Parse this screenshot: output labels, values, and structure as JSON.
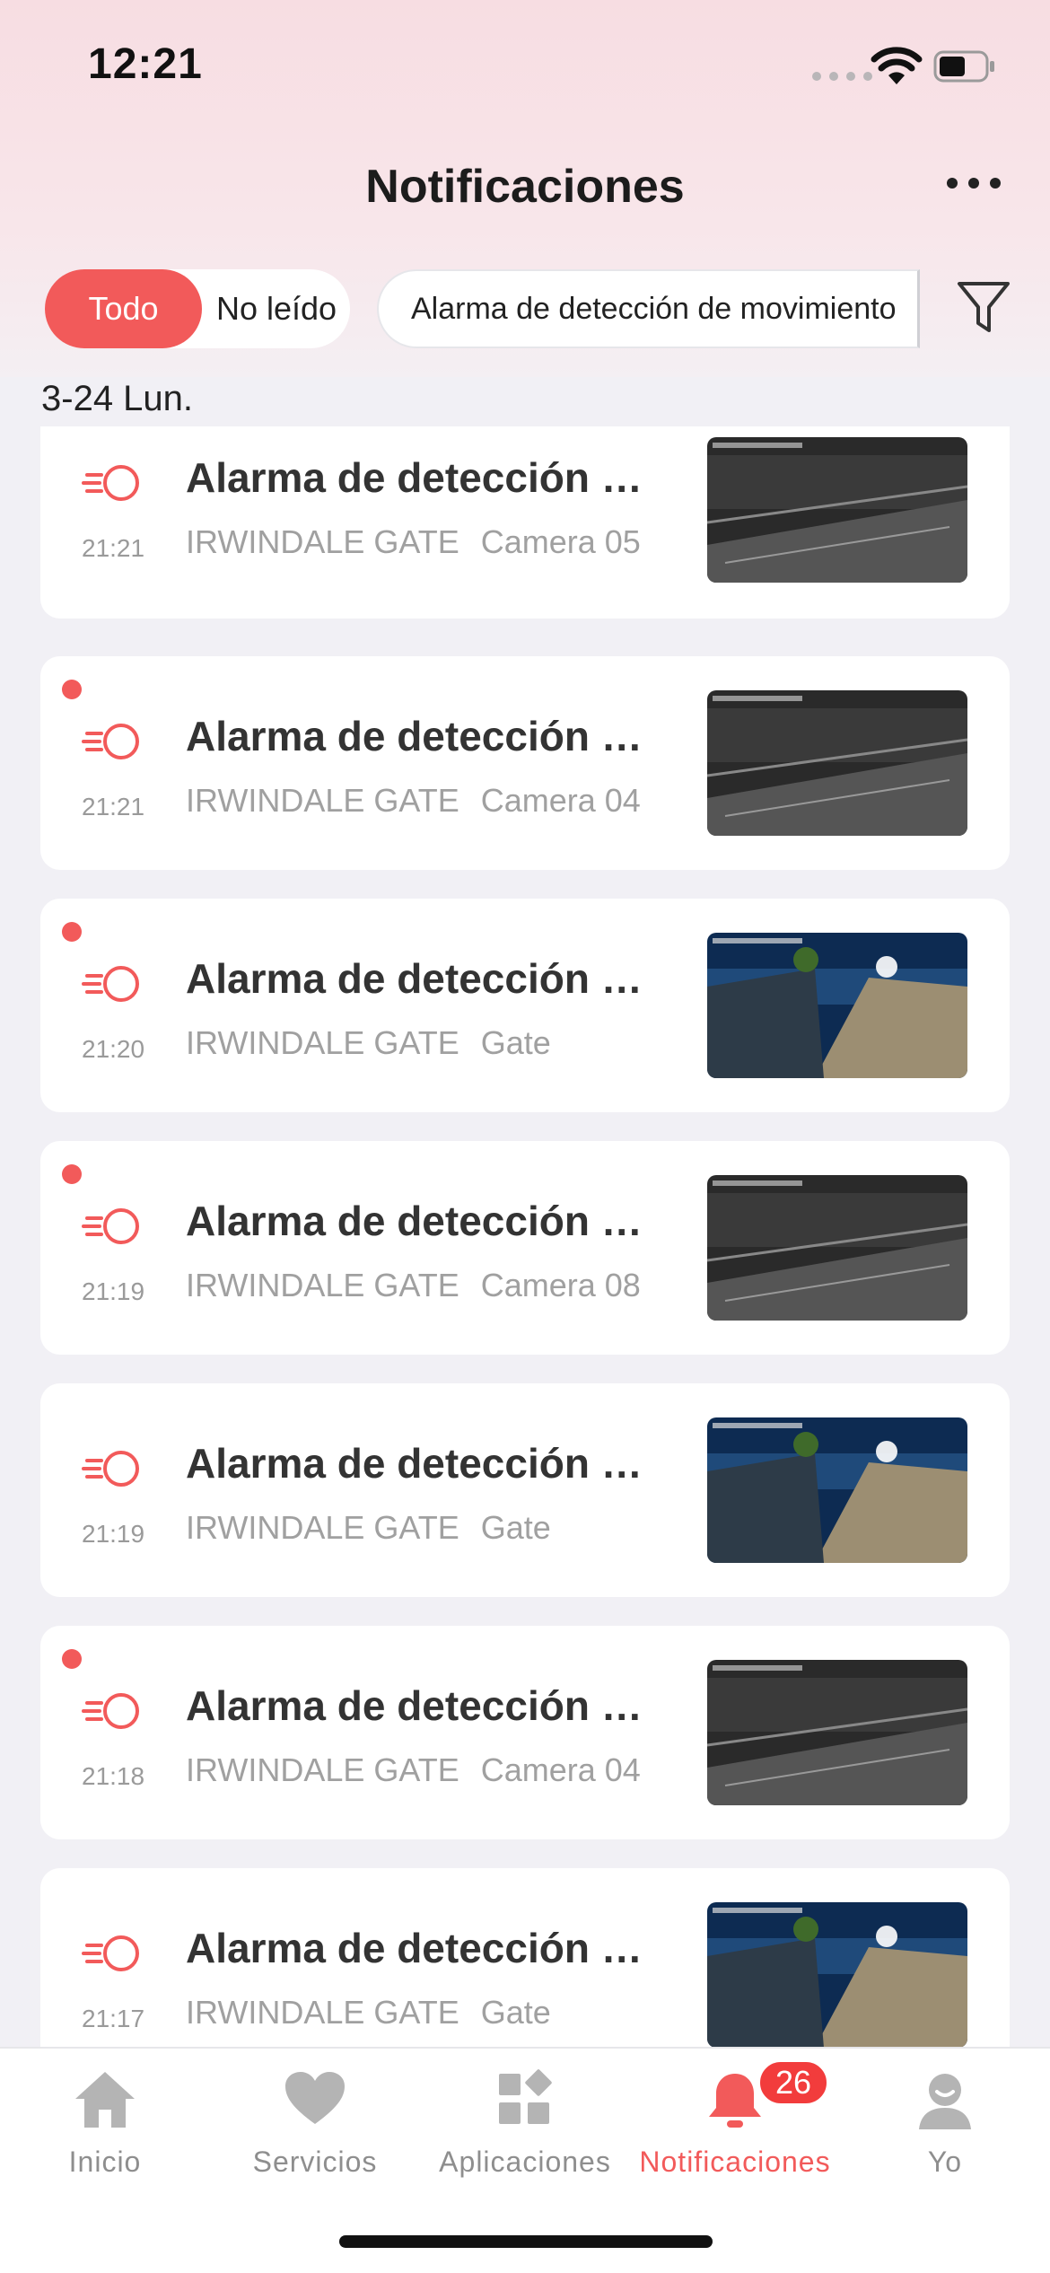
{
  "status_bar": {
    "time": "12:21"
  },
  "header": {
    "title": "Notificaciones",
    "more_icon": "ellipsis-icon"
  },
  "filters": {
    "all_label": "Todo",
    "unread_label": "No leído",
    "type_filter_value": "Alarma de detección de movimiento",
    "filter_icon": "funnel-icon"
  },
  "colors": {
    "accent": "#f25a5a",
    "badge": "#f23c3c"
  },
  "date_header": "3-24 Lun.",
  "notifications": [
    {
      "title": "Alarma de detección de movimiento",
      "time": "21:21",
      "site": "IRWINDALE GATE",
      "camera": "Camera 05",
      "unread": false,
      "thumb": "gray"
    },
    {
      "title": "Alarma de detección de movimiento",
      "time": "21:21",
      "site": "IRWINDALE GATE",
      "camera": "Camera 04",
      "unread": true,
      "thumb": "gray"
    },
    {
      "title": "Alarma de detección de movimiento",
      "time": "21:20",
      "site": "IRWINDALE GATE",
      "camera": "Gate",
      "unread": true,
      "thumb": "color"
    },
    {
      "title": "Alarma de detección de movimiento",
      "time": "21:19",
      "site": "IRWINDALE GATE",
      "camera": "Camera 08",
      "unread": true,
      "thumb": "gray"
    },
    {
      "title": "Alarma de detección de movimiento",
      "time": "21:19",
      "site": "IRWINDALE GATE",
      "camera": "Gate",
      "unread": false,
      "thumb": "color"
    },
    {
      "title": "Alarma de detección de movimiento",
      "time": "21:18",
      "site": "IRWINDALE GATE",
      "camera": "Camera 04",
      "unread": true,
      "thumb": "gray"
    },
    {
      "title": "Alarma de detección de movimiento",
      "time": "21:17",
      "site": "IRWINDALE GATE",
      "camera": "Gate",
      "unread": false,
      "thumb": "color"
    }
  ],
  "tabbar": {
    "tabs": [
      {
        "label": "Inicio",
        "icon": "home-icon"
      },
      {
        "label": "Servicios",
        "icon": "heart-icon"
      },
      {
        "label": "Aplicaciones",
        "icon": "apps-icon"
      },
      {
        "label": "Notificaciones",
        "icon": "bell-icon",
        "badge": "26",
        "active": true
      },
      {
        "label": "Yo",
        "icon": "profile-icon"
      }
    ]
  }
}
